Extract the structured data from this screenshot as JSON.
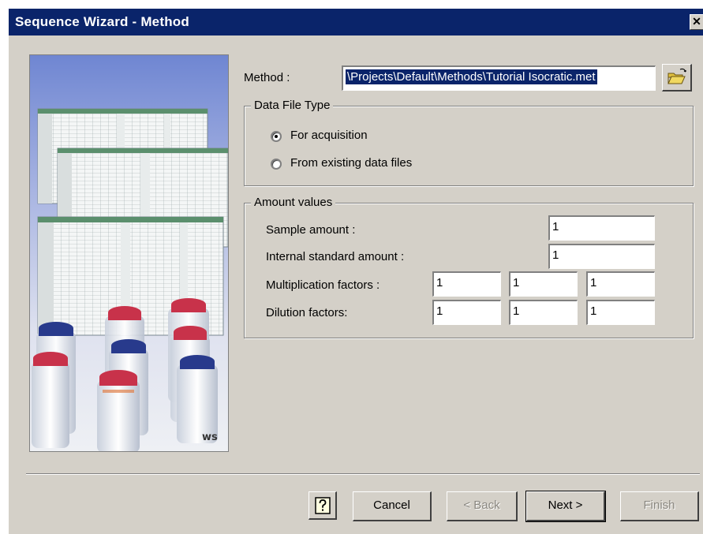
{
  "window": {
    "title": "Sequence Wizard - Method",
    "close_symbol": "✕"
  },
  "method": {
    "label": "Method :",
    "value": "\\Projects\\Default\\Methods\\Tutorial Isocratic.met",
    "browse_icon": "folder-open-icon"
  },
  "data_file_type": {
    "title": "Data File Type",
    "options": [
      {
        "label": "For acquisition",
        "checked": true
      },
      {
        "label": "From existing data files",
        "checked": false
      }
    ]
  },
  "amount_values": {
    "title": "Amount values",
    "sample_amount": {
      "label": "Sample amount :",
      "value": "1"
    },
    "internal_standard_amount": {
      "label": "Internal standard amount :",
      "value": "1"
    },
    "multiplication_factors": {
      "label": "Multiplication factors :",
      "values": [
        "1",
        "1",
        "1"
      ]
    },
    "dilution_factors": {
      "label": "Dilution factors:",
      "values": [
        "1",
        "1",
        "1"
      ]
    }
  },
  "buttons": {
    "help_icon": "help-icon",
    "cancel": "Cancel",
    "back": "< Back",
    "next": "Next >",
    "finish": "Finish"
  },
  "colors": {
    "title_bar": "#0a246a",
    "dialog_face": "#d4d0c8",
    "vial_red": "#c8324a",
    "vial_blue": "#283a8c"
  }
}
